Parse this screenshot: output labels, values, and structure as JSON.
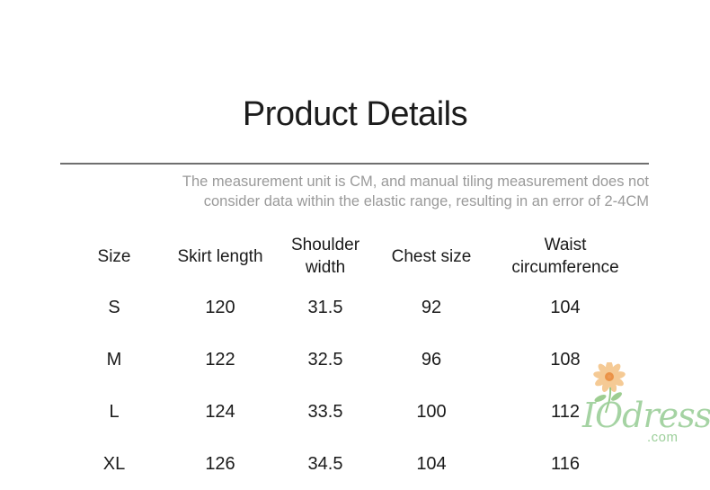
{
  "title": "Product Details",
  "note": {
    "line1": "The measurement unit is CM, and manual tiling measurement does not",
    "line2": "consider data within the elastic range, resulting in an error of 2-4CM"
  },
  "table": {
    "headers": {
      "size": "Size",
      "skirt_length": "Skirt length",
      "shoulder_1": "Shoulder",
      "shoulder_2": "width",
      "chest": "Chest size",
      "waist_1": "Waist",
      "waist_2": "circumference"
    },
    "rows": [
      {
        "size": "S",
        "skirt": "120",
        "shoulder": "31.5",
        "chest": "92",
        "waist": "104"
      },
      {
        "size": "M",
        "skirt": "122",
        "shoulder": "32.5",
        "chest": "96",
        "waist": "108"
      },
      {
        "size": "L",
        "skirt": "124",
        "shoulder": "33.5",
        "chest": "100",
        "waist": "112"
      },
      {
        "size": "XL",
        "skirt": "126",
        "shoulder": "34.5",
        "chest": "104",
        "waist": "116"
      }
    ]
  },
  "watermark": {
    "brand": "IOdress",
    "domain": ".com",
    "colors": {
      "petal": "#f2b56b",
      "stem": "#8cc47e",
      "text": "#9ccf9a"
    }
  }
}
